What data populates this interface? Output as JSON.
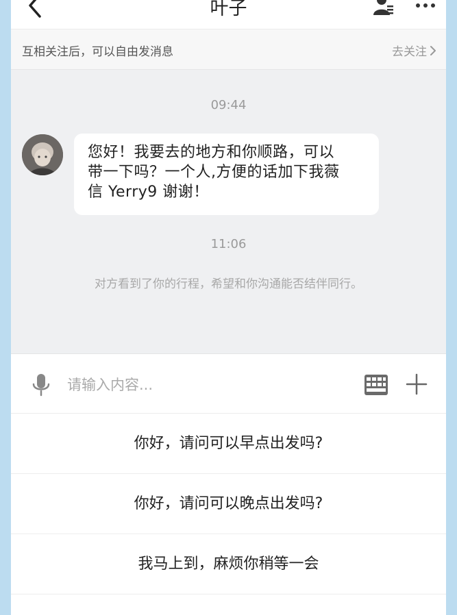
{
  "header": {
    "title": "叶子",
    "back_icon": "chevron-left-icon",
    "profile_icon": "user-profile-icon",
    "more_icon": "more-dots-icon"
  },
  "banner": {
    "text": "互相关注后，可以自由发消息",
    "follow_label": "去关注"
  },
  "chat": {
    "time_1": "09:44",
    "message_lines": [
      "您好！我要去的地方和你顺路，可以",
      "带一下吗？一个人,方便的话加下我薇",
      "信 Yerry9  谢谢！"
    ],
    "time_2": "11:06",
    "system_note": "对方看到了你的行程，希望和你沟通能否结伴同行。"
  },
  "input_bar": {
    "placeholder": "请输入内容...",
    "mic_icon": "microphone-icon",
    "keyboard_icon": "keyboard-icon",
    "plus_icon": "plus-icon"
  },
  "quick_replies": [
    "你好，请问可以早点出发吗?",
    "你好，请问可以晚点出发吗?",
    "我马上到，麻烦你稍等一会"
  ],
  "colors": {
    "outer_background": "#bcdcf0",
    "chat_background": "#eff0f2",
    "bubble": "#ffffff",
    "muted_text": "#9a9a9a"
  }
}
